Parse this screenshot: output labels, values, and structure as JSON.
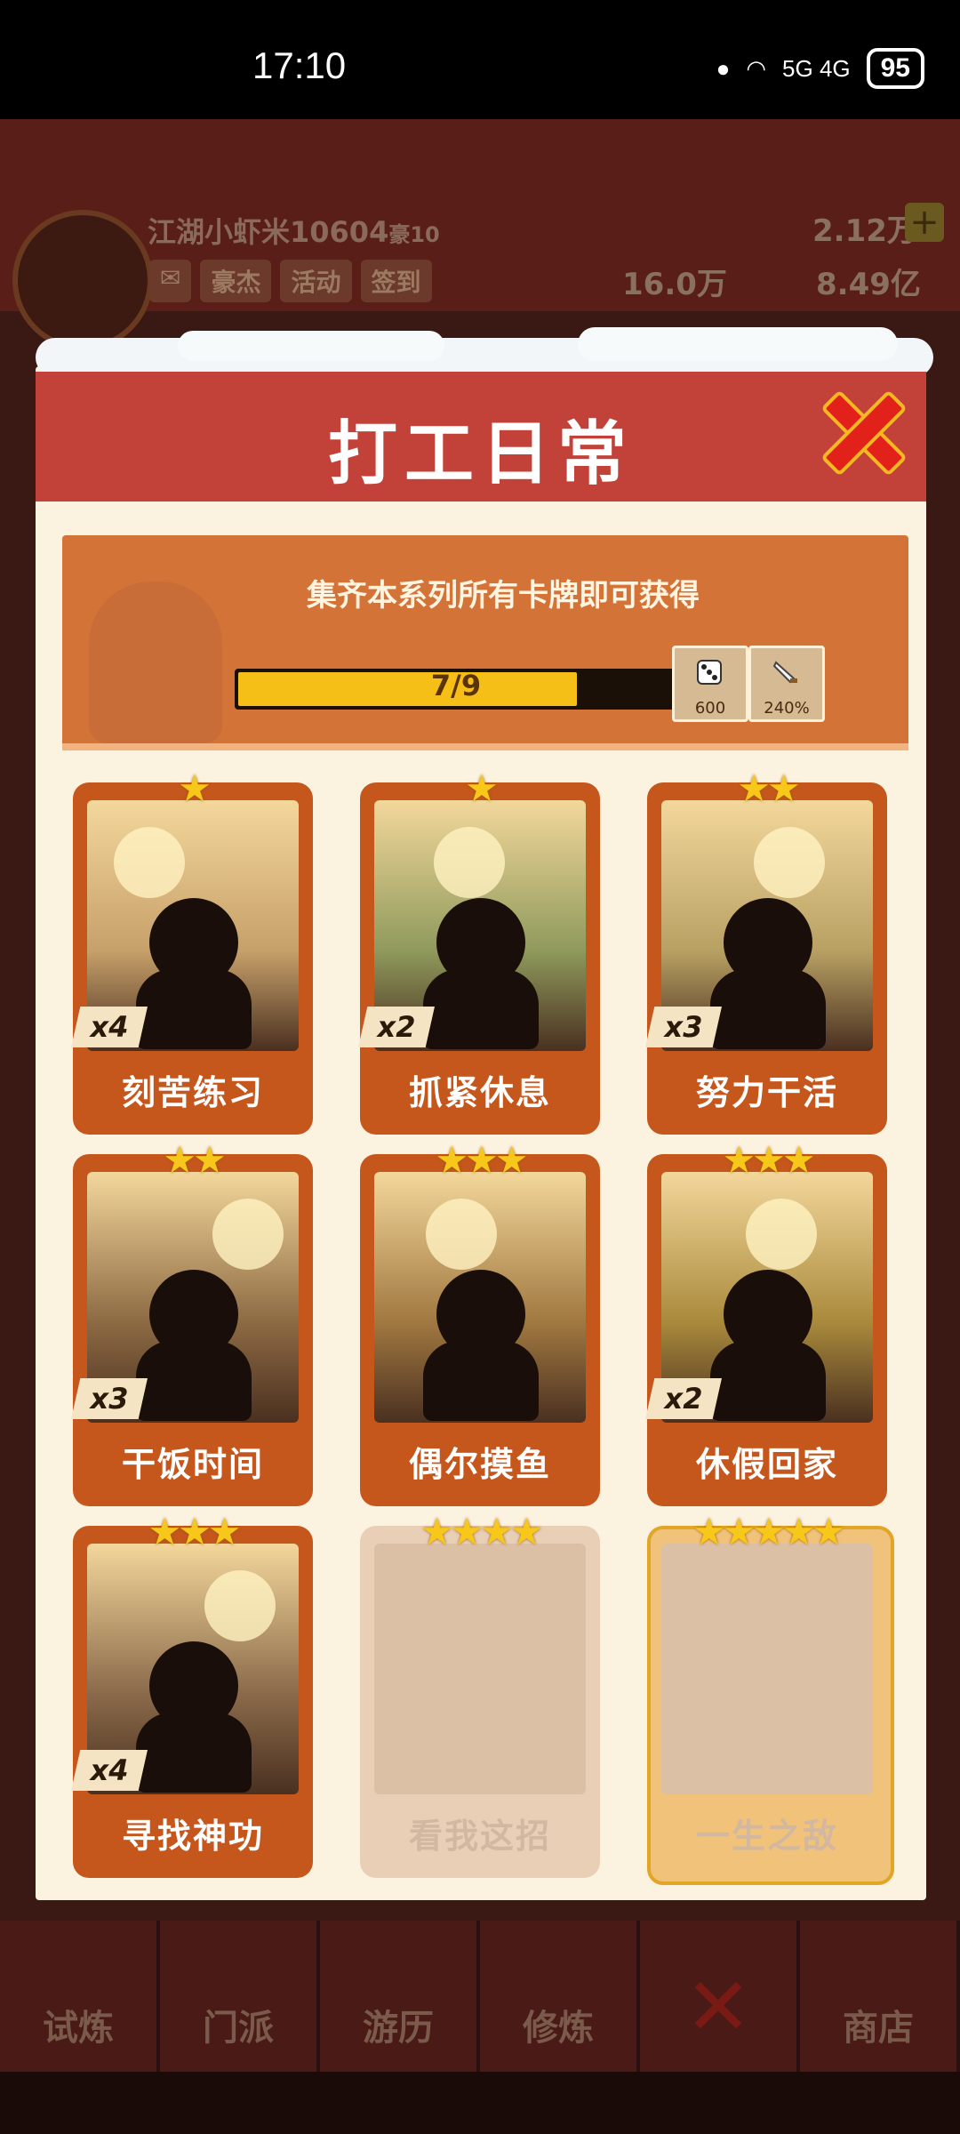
{
  "status_bar": {
    "time": "17:10",
    "network": "5G 4G",
    "battery": "95"
  },
  "player": {
    "name": "江湖小虾米10604",
    "level": "豪10",
    "buttons": [
      "豪杰",
      "活动",
      "签到"
    ]
  },
  "currencies": {
    "gems": "2.12万",
    "tokens": "16.0万",
    "gold": "8.49亿"
  },
  "modal": {
    "title": "打工日常",
    "banner_text": "集齐本系列所有卡牌即可获得",
    "progress": {
      "current": 7,
      "total": 9,
      "label": "7/9"
    },
    "rewards": [
      {
        "icon": "dice-icon",
        "value": "600"
      },
      {
        "icon": "sword-icon",
        "value": "240%"
      }
    ],
    "cards": [
      {
        "name": "刻苦练习",
        "stars": "★",
        "count": "x4",
        "locked": false,
        "theme": "#c7a06a"
      },
      {
        "name": "抓紧休息",
        "stars": "★",
        "count": "x2",
        "locked": false,
        "theme": "#8f9a5c"
      },
      {
        "name": "努力干活",
        "stars": "★★",
        "count": "x3",
        "locked": false,
        "theme": "#b8a063"
      },
      {
        "name": "干饭时间",
        "stars": "★★",
        "count": "x3",
        "locked": false,
        "theme": "#8d6a43"
      },
      {
        "name": "偶尔摸鱼",
        "stars": "★★★",
        "count": "",
        "locked": false,
        "theme": "#a07840"
      },
      {
        "name": "休假回家",
        "stars": "★★★",
        "count": "x2",
        "locked": false,
        "theme": "#a98a3c"
      },
      {
        "name": "寻找神功",
        "stars": "★★★",
        "count": "x4",
        "locked": false,
        "theme": "#8a6a4a"
      },
      {
        "name": "看我这招",
        "stars": "★★★★",
        "count": "",
        "locked": true,
        "theme": "#dcc0a6"
      },
      {
        "name": "一生之敌",
        "stars": "★★★★★",
        "count": "",
        "locked": true,
        "theme": "#dcc0a6"
      }
    ]
  },
  "bottom_nav": [
    "试炼",
    "门派",
    "游历",
    "修炼",
    "",
    "商店"
  ]
}
